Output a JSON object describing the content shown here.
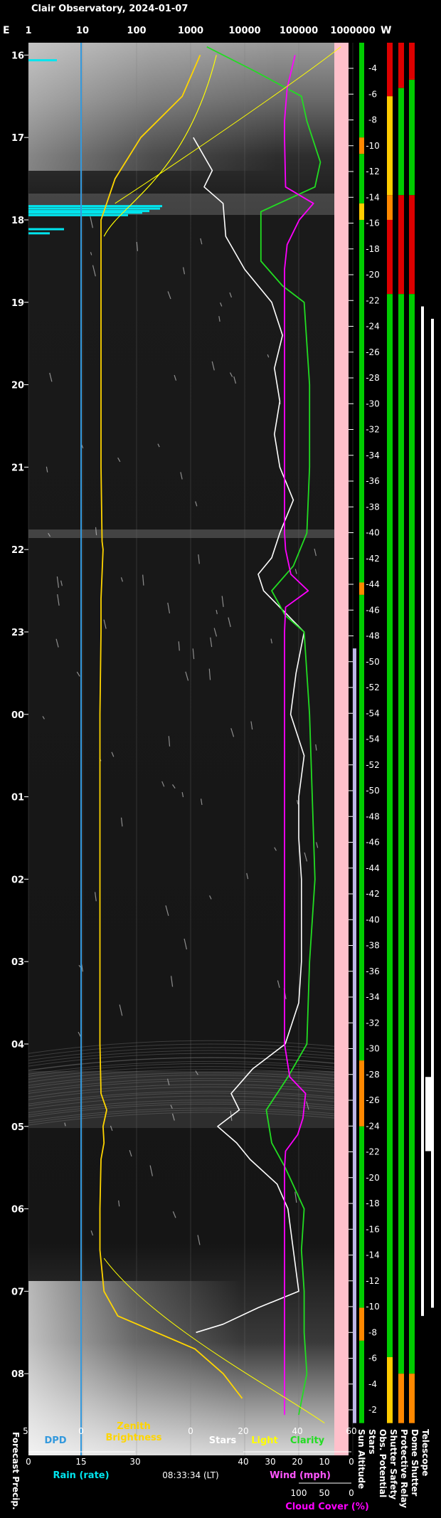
{
  "header": {
    "title": "Clair Observatory, 2024-01-07",
    "left_mark": "E",
    "right_mark": "W"
  },
  "top_axis": {
    "labels": [
      "1",
      "10",
      "100",
      "1000",
      "10000",
      "100000",
      "1000000"
    ]
  },
  "time_axis": {
    "labels": [
      "16",
      "17",
      "18",
      "19",
      "20",
      "21",
      "22",
      "23",
      "00",
      "01",
      "02",
      "03",
      "04",
      "05",
      "06",
      "07",
      "08"
    ]
  },
  "sun_altitude_axis": {
    "labels": [
      "-4",
      "-6",
      "-8",
      "-10",
      "-12",
      "-14",
      "-16",
      "-18",
      "-20",
      "-22",
      "-24",
      "-26",
      "-28",
      "-30",
      "-32",
      "-34",
      "-36",
      "-38",
      "-40",
      "-42",
      "-44",
      "-46",
      "-48",
      "-50",
      "-52",
      "-54",
      "-54",
      "-52",
      "-50",
      "-48",
      "-46",
      "-44",
      "-42",
      "-40",
      "-38",
      "-36",
      "-34",
      "-32",
      "-30",
      "-28",
      "-26",
      "-24",
      "-22",
      "-20",
      "-18",
      "-16",
      "-14",
      "-12",
      "-10",
      "-8",
      "-6",
      "-4",
      "-2"
    ]
  },
  "status_columns": [
    {
      "label": "Sun Altitude"
    },
    {
      "label": "Stars"
    },
    {
      "label": "Obs. Potential"
    },
    {
      "label": "Shutter Safety"
    },
    {
      "label": "Protective Relay"
    },
    {
      "label": "Dome Shutter"
    },
    {
      "label": "Telescope"
    }
  ],
  "bottom_axes": {
    "forecast_label": "Forecast Precip.",
    "dpd": {
      "label": "DPD",
      "ticks": [
        "5",
        "0"
      ]
    },
    "rain": {
      "label": "Rain (rate)",
      "ticks": [
        "0",
        "15",
        "30"
      ]
    },
    "zenith": {
      "label": "Zenith\nBrightness",
      "line1": "Zenith",
      "line2": "Brightness",
      "ticks": [
        "0"
      ]
    },
    "stars": {
      "label": "Stars",
      "ticks": [
        "20",
        "40",
        "60"
      ]
    },
    "light": {
      "label": "Light"
    },
    "clarity": {
      "label": "Clarity"
    },
    "wind": {
      "label": "Wind (mph)",
      "ticks": [
        "40",
        "30",
        "20",
        "10",
        "0"
      ]
    },
    "cloud": {
      "label": "Cloud Cover (%)",
      "ticks": [
        "100",
        "50",
        "0"
      ]
    },
    "timestamp": "08:33:34 (LT)"
  },
  "colors": {
    "dpd": "#3399dd",
    "rain": "#00e5ee",
    "zenith": "#ffd500",
    "stars": "#ffffff",
    "light": "#ffff00",
    "clarity": "#22dd22",
    "wind": "#ff55ff",
    "cloud": "#ff00ff",
    "pink_band": "#ffc0cb",
    "status_red": "#dd0000",
    "status_green": "#00cc00",
    "status_yellow": "#ffcc00",
    "status_orange": "#ff8800"
  },
  "chart_data": {
    "type": "line",
    "title": "Clair Observatory, 2024-01-07",
    "x_axis": "local time (hours)",
    "x_range": [
      "15:45",
      "08:35"
    ],
    "top_scale": "log",
    "series": [
      {
        "name": "Zenith Brightness",
        "points": [
          [
            16.0,
            1500
          ],
          [
            16.5,
            700
          ],
          [
            17.0,
            120
          ],
          [
            17.5,
            40
          ],
          [
            17.8,
            28
          ],
          [
            18.0,
            22
          ],
          [
            18.5,
            22
          ],
          [
            19.0,
            22
          ],
          [
            20.0,
            22
          ],
          [
            21.0,
            22
          ],
          [
            21.9,
            23
          ],
          [
            22.0,
            24
          ],
          [
            22.6,
            22
          ],
          [
            23.0,
            22
          ],
          [
            24.0,
            21
          ],
          [
            25.0,
            21
          ],
          [
            26.0,
            21
          ],
          [
            27.0,
            21
          ],
          [
            28.0,
            21
          ],
          [
            28.6,
            22
          ],
          [
            28.8,
            28
          ],
          [
            29.0,
            24
          ],
          [
            29.2,
            25
          ],
          [
            29.4,
            22
          ],
          [
            30.0,
            21
          ],
          [
            30.5,
            21
          ],
          [
            31.0,
            25
          ],
          [
            31.3,
            45
          ],
          [
            31.7,
            1200
          ],
          [
            32.0,
            4000
          ],
          [
            32.3,
            9000
          ]
        ]
      },
      {
        "name": "Stars",
        "points": [
          [
            17.0,
            1
          ],
          [
            17.4,
            8
          ],
          [
            17.6,
            5
          ],
          [
            17.8,
            12
          ],
          [
            18.2,
            13
          ],
          [
            18.6,
            20
          ],
          [
            19.0,
            30
          ],
          [
            19.4,
            34
          ],
          [
            19.8,
            31
          ],
          [
            20.2,
            33
          ],
          [
            20.6,
            31
          ],
          [
            21.0,
            33
          ],
          [
            21.4,
            38
          ],
          [
            21.8,
            33
          ],
          [
            22.1,
            30
          ],
          [
            22.3,
            25
          ],
          [
            22.5,
            27
          ],
          [
            22.8,
            36
          ],
          [
            23.0,
            42
          ],
          [
            23.5,
            39
          ],
          [
            24.0,
            37
          ],
          [
            24.5,
            42
          ],
          [
            25.0,
            40
          ],
          [
            25.5,
            40
          ],
          [
            26.0,
            41
          ],
          [
            26.5,
            41
          ],
          [
            27.0,
            41
          ],
          [
            27.5,
            40
          ],
          [
            28.0,
            35
          ],
          [
            28.3,
            23
          ],
          [
            28.6,
            15
          ],
          [
            28.8,
            18
          ],
          [
            29.0,
            10
          ],
          [
            29.2,
            17
          ],
          [
            29.4,
            22
          ],
          [
            29.7,
            32
          ],
          [
            30.0,
            36
          ],
          [
            30.5,
            38
          ],
          [
            31.0,
            40
          ],
          [
            31.2,
            25
          ],
          [
            31.4,
            12
          ],
          [
            31.5,
            2
          ]
        ]
      },
      {
        "name": "Clarity",
        "points": [
          [
            15.9,
            6
          ],
          [
            16.2,
            24
          ],
          [
            16.5,
            41
          ],
          [
            16.8,
            43
          ],
          [
            17.0,
            45
          ],
          [
            17.3,
            48
          ],
          [
            17.6,
            46
          ],
          [
            17.9,
            26
          ],
          [
            18.2,
            26
          ],
          [
            18.5,
            26
          ],
          [
            18.8,
            34
          ],
          [
            19.0,
            42
          ],
          [
            19.5,
            43
          ],
          [
            20.0,
            44
          ],
          [
            21.0,
            44
          ],
          [
            21.8,
            43
          ],
          [
            22.2,
            38
          ],
          [
            22.5,
            30
          ],
          [
            22.8,
            35
          ],
          [
            23.0,
            42
          ],
          [
            24.0,
            44
          ],
          [
            25.0,
            45
          ],
          [
            26.0,
            46
          ],
          [
            27.0,
            44
          ],
          [
            28.0,
            43
          ],
          [
            28.4,
            36
          ],
          [
            28.8,
            28
          ],
          [
            29.2,
            30
          ],
          [
            29.5,
            35
          ],
          [
            30.0,
            42
          ],
          [
            30.5,
            41
          ],
          [
            31.0,
            42
          ],
          [
            31.5,
            42
          ],
          [
            32.0,
            43
          ],
          [
            32.5,
            40
          ]
        ]
      },
      {
        "name": "Cloud Cover",
        "points": [
          [
            16.0,
            80
          ],
          [
            16.4,
            95
          ],
          [
            16.8,
            100
          ],
          [
            17.0,
            100
          ],
          [
            17.6,
            98
          ],
          [
            17.8,
            45
          ],
          [
            18.0,
            72
          ],
          [
            18.3,
            95
          ],
          [
            18.6,
            100
          ],
          [
            21.8,
            100
          ],
          [
            22.0,
            98
          ],
          [
            22.3,
            88
          ],
          [
            22.5,
            55
          ],
          [
            22.7,
            98
          ],
          [
            23.0,
            100
          ],
          [
            28.0,
            100
          ],
          [
            28.4,
            90
          ],
          [
            28.6,
            60
          ],
          [
            28.9,
            65
          ],
          [
            29.1,
            75
          ],
          [
            29.3,
            98
          ],
          [
            29.5,
            100
          ],
          [
            32.5,
            100
          ]
        ]
      }
    ]
  }
}
